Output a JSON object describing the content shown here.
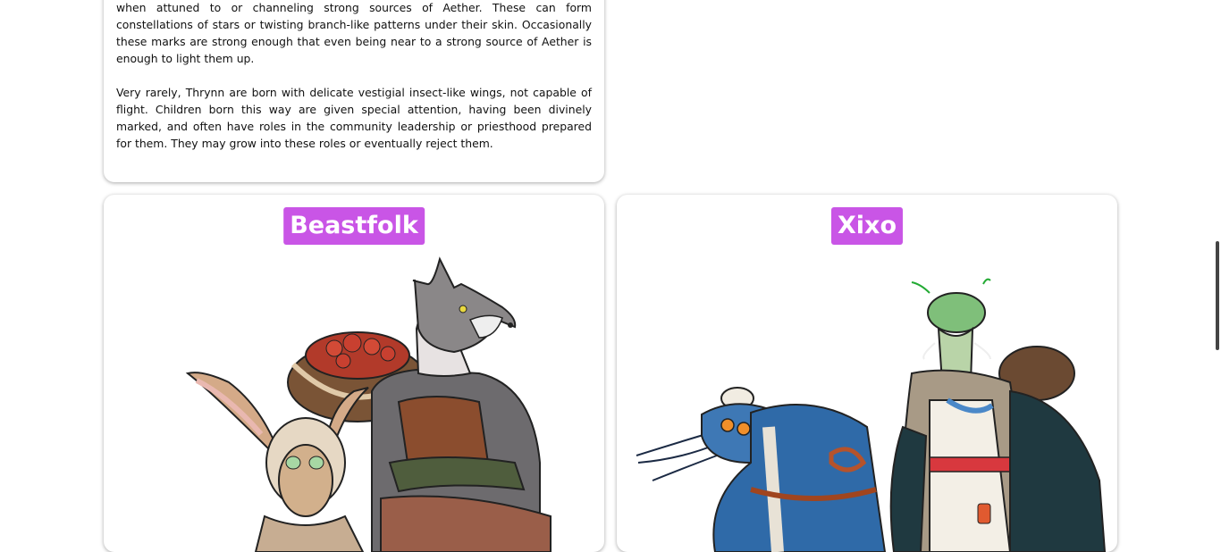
{
  "lore": {
    "paragraph1": "when attuned to or channeling strong sources of Aether. These can form constellations of stars or twisting branch-like patterns under their skin. Occasionally these marks are strong enough that even being near to a strong source of Aether is enough to light them up.",
    "paragraph2": "Very rarely, Thrynn are born with delicate vestigial insect-like wings, not capable of flight. Children born this way are given special attention, having been divinely marked, and often have roles in the community leadership or priesthood prepared for them. They may grow into these roles or eventually reject them."
  },
  "races": [
    {
      "title": "Beastfolk",
      "art": "beastfolk-illustration"
    },
    {
      "title": "Xixo",
      "art": "xixo-illustration"
    }
  ],
  "colors": {
    "title_bg": "#c955e6",
    "title_fg": "#ffffff"
  }
}
